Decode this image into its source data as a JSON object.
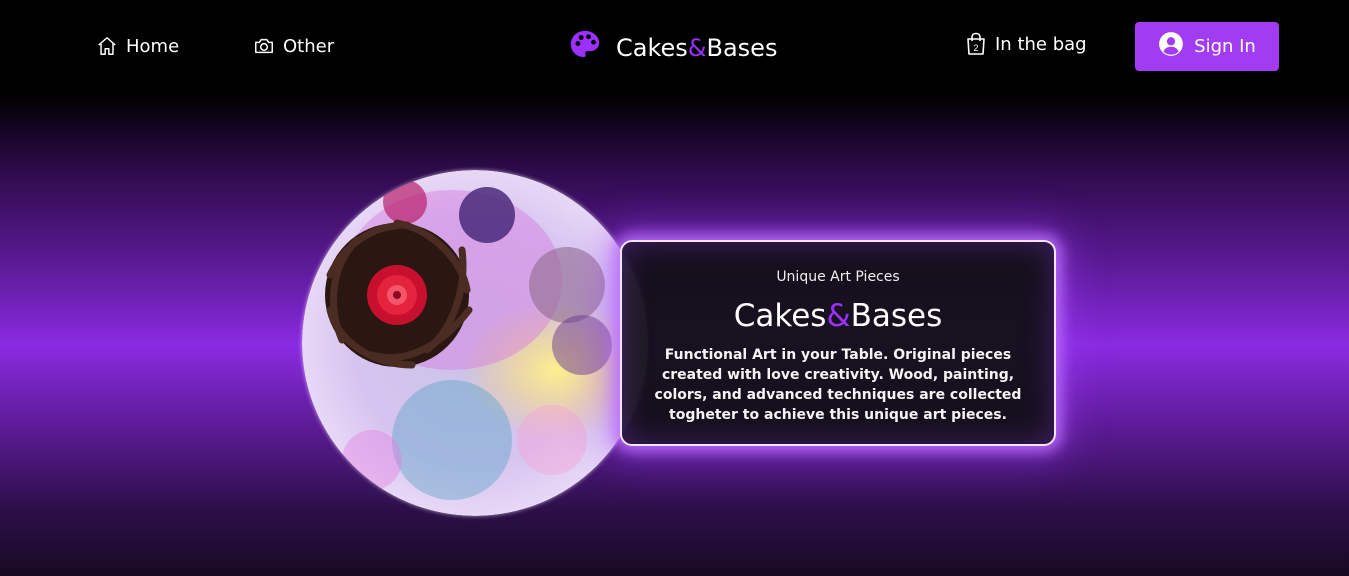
{
  "nav": {
    "home_label": "Home",
    "other_label": "Other",
    "brand_part1": "Cakes",
    "brand_amp": "&",
    "brand_part2": "Bases",
    "bag_label": "In the bag",
    "bag_count": "2",
    "signin_label": "Sign In"
  },
  "hero": {
    "kicker": "Unique Art Pieces",
    "title_part1": "Cakes",
    "title_amp": "&",
    "title_part2": "Bases",
    "description": "Functional Art in your Table. Original pieces created with love creativity. Wood, painting, colors, and advanced techniques are collected togheter to achieve this unique art pieces."
  },
  "icons": {
    "home": "home-icon",
    "other": "camera-icon",
    "brand": "palette-icon",
    "bag": "shopping-bag-icon",
    "signin": "user-circle-icon"
  },
  "colors": {
    "accent": "#9b30ff",
    "signin_bg": "#a23cf2",
    "hero_glow": "#8a2be2"
  }
}
